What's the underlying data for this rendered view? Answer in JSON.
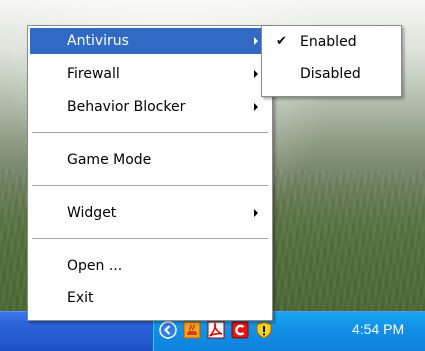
{
  "main_menu": {
    "items": [
      {
        "label": "Antivirus",
        "has_submenu": true,
        "highlighted": true
      },
      {
        "label": "Firewall",
        "has_submenu": true
      },
      {
        "label": "Behavior Blocker",
        "has_submenu": true
      },
      {
        "label": "Game Mode",
        "has_submenu": false
      },
      {
        "label": "Widget",
        "has_submenu": true
      },
      {
        "label": "Open ...",
        "has_submenu": false
      },
      {
        "label": "Exit",
        "has_submenu": false
      }
    ]
  },
  "submenu": {
    "items": [
      {
        "label": "Enabled",
        "checked": true,
        "check_glyph": "✔"
      },
      {
        "label": "Disabled",
        "checked": false
      }
    ]
  },
  "taskbar": {
    "clock": "4:54 PM",
    "tray_icons": [
      "show-hidden-icons-chevron",
      "java-icon",
      "adobe-acrobat-icon",
      "antivirus-red-c-icon",
      "security-shield-icon"
    ]
  },
  "colors": {
    "highlight": "#316ac5",
    "taskbar": "#235ad3",
    "tray": "#128fe6"
  }
}
